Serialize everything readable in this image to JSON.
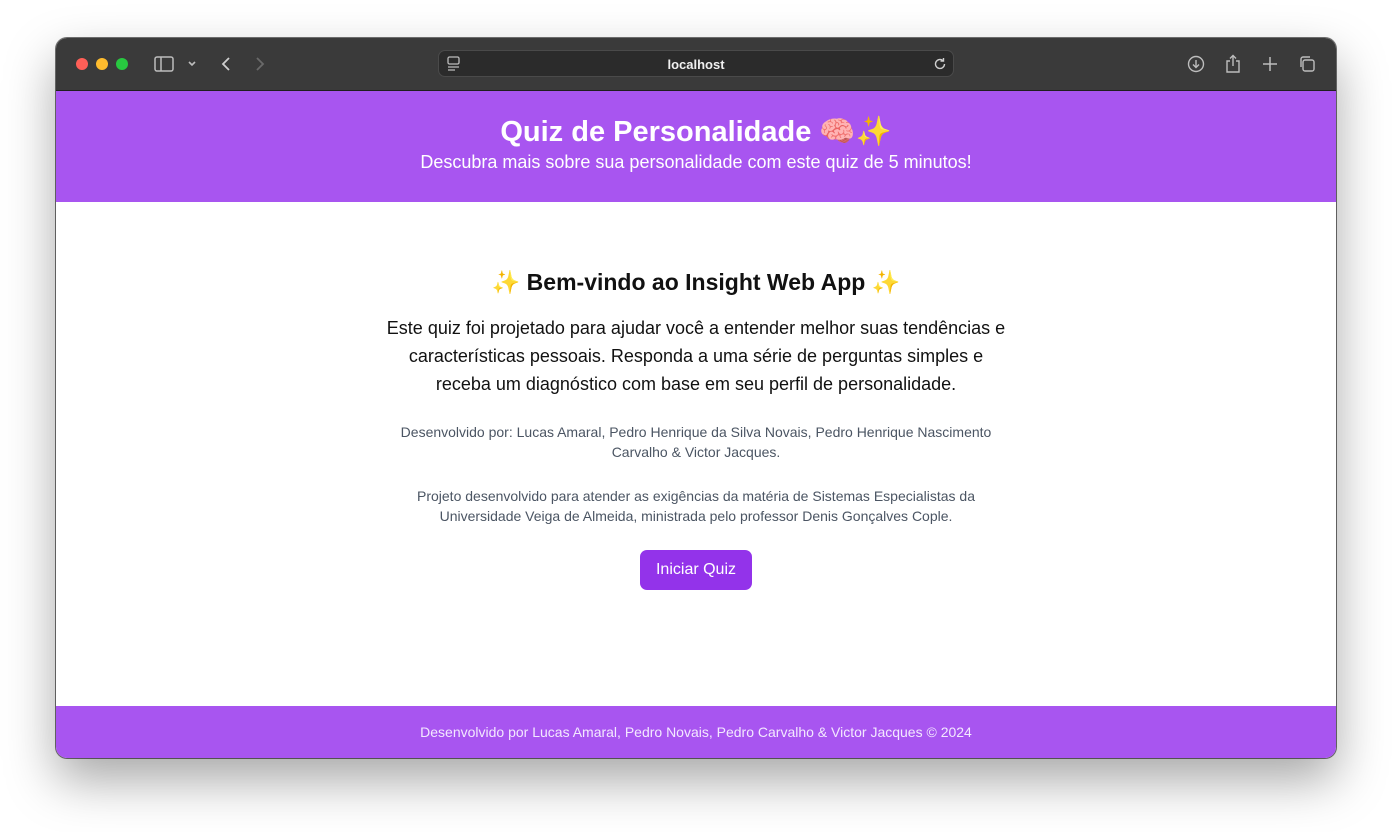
{
  "browser": {
    "url": "localhost"
  },
  "header": {
    "title": "Quiz de Personalidade 🧠✨",
    "subtitle": "Descubra mais sobre sua personalidade com este quiz de 5 minutos!"
  },
  "main": {
    "welcome": "✨ Bem-vindo ao Insight Web App ✨",
    "intro": "Este quiz foi projetado para ajudar você a entender melhor suas tendências e características pessoais. Responda a uma série de perguntas simples e receba um diagnóstico com base em seu perfil de personalidade.",
    "developers": "Desenvolvido por: Lucas Amaral, Pedro Henrique da Silva Novais, Pedro Henrique Nascimento Carvalho & Victor Jacques.",
    "project_note": "Projeto desenvolvido para atender as exigências da matéria de Sistemas Especialistas da Universidade Veiga de Almeida, ministrada pelo professor Denis Gonçalves Cople.",
    "start_button": "Iniciar Quiz"
  },
  "footer": {
    "text": "Desenvolvido por Lucas Amaral, Pedro Novais, Pedro Carvalho & Victor Jacques © 2024"
  },
  "colors": {
    "header_bg": "#a855f0",
    "button_bg": "#9333ea",
    "toolbar_bg": "#3a3a3a"
  },
  "icons": [
    "sidebar-icon",
    "chevron-down-icon",
    "back-icon",
    "forward-icon",
    "site-settings-icon",
    "reload-icon",
    "download-icon",
    "share-icon",
    "new-tab-icon",
    "tab-overview-icon"
  ]
}
